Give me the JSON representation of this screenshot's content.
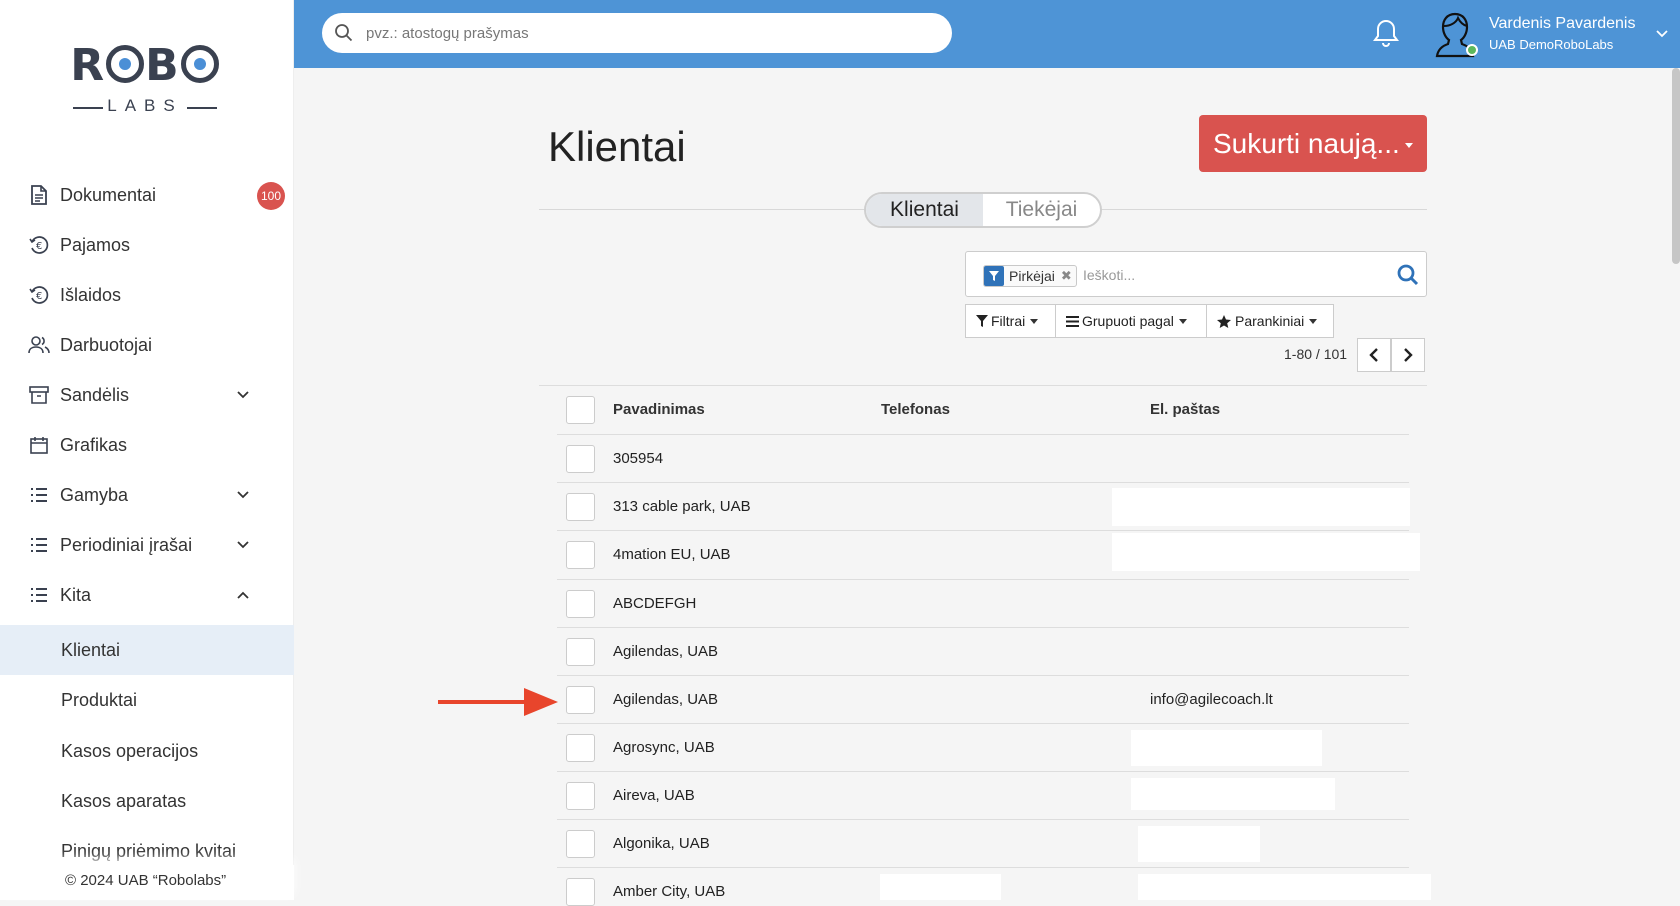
{
  "brand": {
    "logo_top": "ROBO",
    "logo_bottom": "LABS"
  },
  "sidebar": {
    "items": [
      {
        "label": "Dokumentai",
        "icon": "document-icon",
        "badge": "100"
      },
      {
        "label": "Pajamos",
        "icon": "euro-in-icon"
      },
      {
        "label": "Išlaidos",
        "icon": "euro-out-icon"
      },
      {
        "label": "Darbuotojai",
        "icon": "users-icon"
      },
      {
        "label": "Sandėlis",
        "icon": "archive-icon",
        "chevron": "down"
      },
      {
        "label": "Grafikas",
        "icon": "calendar-icon"
      },
      {
        "label": "Gamyba",
        "icon": "list-icon",
        "chevron": "down"
      },
      {
        "label": "Periodiniai įrašai",
        "icon": "list-icon",
        "chevron": "down"
      },
      {
        "label": "Kita",
        "icon": "list-icon",
        "chevron": "up"
      }
    ],
    "sub_items": [
      {
        "label": "Klientai",
        "active": true
      },
      {
        "label": "Produktai"
      },
      {
        "label": "Kasos operacijos"
      },
      {
        "label": "Kasos aparatas"
      },
      {
        "label": "Pinigų priėmimo kvitai"
      }
    ],
    "footer": "© 2024 UAB “Robolabs”"
  },
  "topbar": {
    "search_placeholder": "pvz.: atostogų prašymas",
    "user_name": "Vardenis Pavardenis",
    "company": "UAB DemoRoboLabs",
    "bg_color": "#4e94d6"
  },
  "page": {
    "title": "Klientai",
    "create_button": "Sukurti naują...",
    "tabs": [
      {
        "label": "Klientai",
        "active": true
      },
      {
        "label": "Tiekėjai",
        "active": false
      }
    ],
    "filter_chip": "Pirkėjai",
    "filter_placeholder": "Ieškoti...",
    "toolbar": {
      "filters": "Filtrai",
      "group_by": "Grupuoti pagal",
      "favorites": "Parankiniai"
    },
    "pager": "1-80 / 101",
    "accent_color": "#d9534f"
  },
  "table": {
    "columns": [
      "Pavadinimas",
      "Telefonas",
      "El. paštas"
    ],
    "rows": [
      {
        "name": "305954",
        "phone": "",
        "email": ""
      },
      {
        "name": "313 cable park, UAB",
        "phone": "",
        "email": ""
      },
      {
        "name": "4mation EU, UAB",
        "phone": "",
        "email": ""
      },
      {
        "name": "ABCDEFGH",
        "phone": "",
        "email": ""
      },
      {
        "name": "Agilendas, UAB",
        "phone": "",
        "email": ""
      },
      {
        "name": "Agilendas, UAB",
        "phone": "",
        "email": "info@agilecoach.lt"
      },
      {
        "name": "Agrosync, UAB",
        "phone": "",
        "email": ""
      },
      {
        "name": "Aireva, UAB",
        "phone": "",
        "email": ""
      },
      {
        "name": "Algonika, UAB",
        "phone": "",
        "email": ""
      },
      {
        "name": "Amber City, UAB",
        "phone": "",
        "email": ""
      }
    ]
  }
}
